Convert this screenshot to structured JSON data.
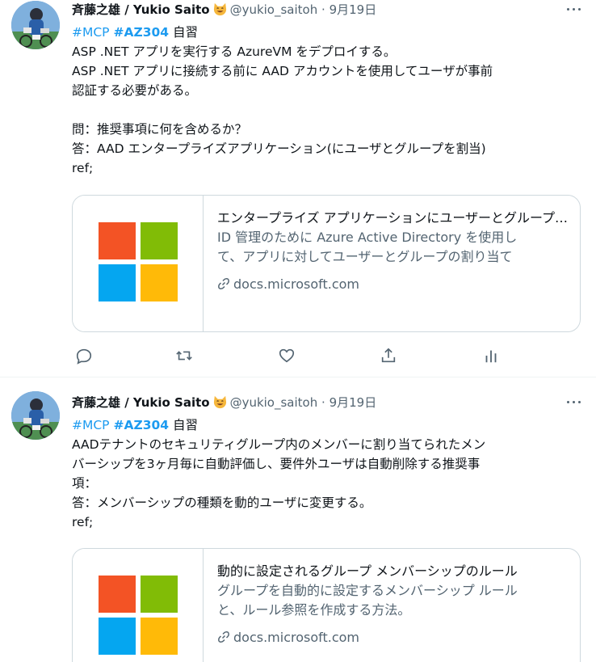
{
  "colors": {
    "text": "#0f1419",
    "muted": "#536471",
    "link": "#1d9bf0",
    "border": "#cfd9de",
    "ms_red": "#f35325",
    "ms_green": "#81bc06",
    "ms_blue": "#05a6f0",
    "ms_yellow": "#ffba08"
  },
  "tweets": [
    {
      "display_name": "斉藤之雄 / Yukio Saito",
      "emoji": "😺",
      "handle": "@yukio_saitoh",
      "separator": "·",
      "date": "9月19日",
      "hashtag_mcp": "#MCP",
      "hashtag_az": "#AZ304",
      "tag_suffix": " 自習",
      "lines": [
        "ASP .NET アプリを実行する AzureVM をデプロイする。",
        "ASP .NET アプリに接続する前に AAD アカウントを使用してユーザが事前",
        "認証する必要がある。",
        "",
        "問：推奨事項に何を含めるか？",
        "答：AAD エンタープライズアプリケーション(にユーザとグループを割当)",
        "ref;"
      ],
      "card": {
        "title": "エンタープライズ アプリケーションにユーザーとグループを割り当てる",
        "description_1": "ID 管理のために Azure Active Directory を使用し",
        "description_2": "て、アプリに対してユーザーとグループの割り当て",
        "domain": "docs.microsoft.com",
        "icon": "link-icon"
      },
      "actions": [
        "reply-icon",
        "retweet-icon",
        "like-icon",
        "share-icon",
        "analytics-icon"
      ]
    },
    {
      "display_name": "斉藤之雄 / Yukio Saito",
      "emoji": "😺",
      "handle": "@yukio_saitoh",
      "separator": "·",
      "date": "9月19日",
      "hashtag_mcp": "#MCP",
      "hashtag_az": "#AZ304",
      "tag_suffix": " 自習",
      "lines": [
        "AADテナントのセキュリティグループ内のメンバーに割り当てられたメン",
        "バーシップを3ヶ月毎に自動評価し、要件外ユーザは自動削除する推奨事",
        "項：",
        "答：メンバーシップの種類を動的ユーザに変更する。",
        "ref;"
      ],
      "card": {
        "title": "動的に設定されるグループ メンバーシップのルール",
        "description_1": "グループを自動的に設定するメンバーシップ ルール",
        "description_2": "と、ルール参照を作成する方法。",
        "domain": "docs.microsoft.com",
        "icon": "link-icon"
      }
    }
  ]
}
